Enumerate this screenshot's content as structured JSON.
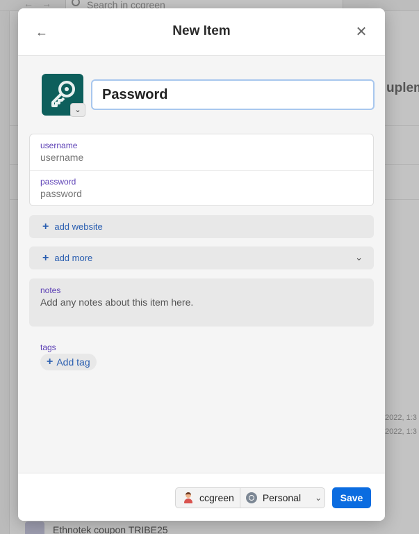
{
  "background": {
    "search_placeholder": "Search in ccgreen",
    "heading_fragment": "uplem",
    "dates": [
      "2022, 1:3",
      "2022, 1:3"
    ],
    "bottom_item": "Ethnotek coupon TRIBE25"
  },
  "modal": {
    "title": "New Item",
    "item_title": "Password",
    "icon": "key-icon",
    "fields": [
      {
        "label": "username",
        "placeholder": "username"
      },
      {
        "label": "password",
        "placeholder": "password"
      }
    ],
    "add_website": "add website",
    "add_more": "add more",
    "notes": {
      "label": "notes",
      "placeholder": "Add any notes about this item here."
    },
    "tags": {
      "label": "tags",
      "add_label": "Add tag"
    },
    "footer": {
      "account": "ccgreen",
      "vault": "Personal",
      "save_label": "Save"
    }
  },
  "colors": {
    "icon_bg": "#0d5f5c",
    "accent": "#0b6ce0",
    "label": "#5b3fb5",
    "link": "#2a5eb0"
  }
}
